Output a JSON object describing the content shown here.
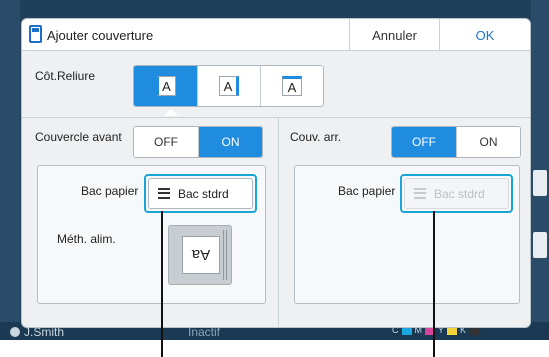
{
  "background": {
    "user": "J.Smith",
    "status": "Inactif",
    "color_labels": [
      "C",
      "M",
      "Y",
      "K"
    ],
    "colors": {
      "cyan": "#1ba6e0",
      "magenta": "#d8459a",
      "yellow": "#f2d33a",
      "black": "#333333"
    }
  },
  "dialog": {
    "title": "Ajouter couverture",
    "cancel_label": "Annuler",
    "ok_label": "OK",
    "binding": {
      "label": "Côt.Reliure",
      "options": [
        "A",
        "A",
        "A"
      ],
      "selected": "left"
    },
    "front_cover": {
      "label": "Couvercle avant",
      "off_label": "OFF",
      "on_label": "ON",
      "value": "ON",
      "tray_label": "Bac papier",
      "tray_value": "Bac stdrd",
      "feed_label": "Méth. alim.",
      "feed_glyph": "Aa"
    },
    "back_cover": {
      "label": "Couv. arr.",
      "off_label": "OFF",
      "on_label": "ON",
      "value": "OFF",
      "tray_label": "Bac papier",
      "tray_value": "Bac stdrd"
    }
  },
  "colors": {
    "accent": "#1f8ce0",
    "ok_text": "#1b76d2",
    "callout": "#19a6d6",
    "app_background": "#1f3f5a"
  },
  "icons": [
    "document-icon",
    "paper-tray-icon",
    "feed-direction-icon",
    "user-icon"
  ]
}
